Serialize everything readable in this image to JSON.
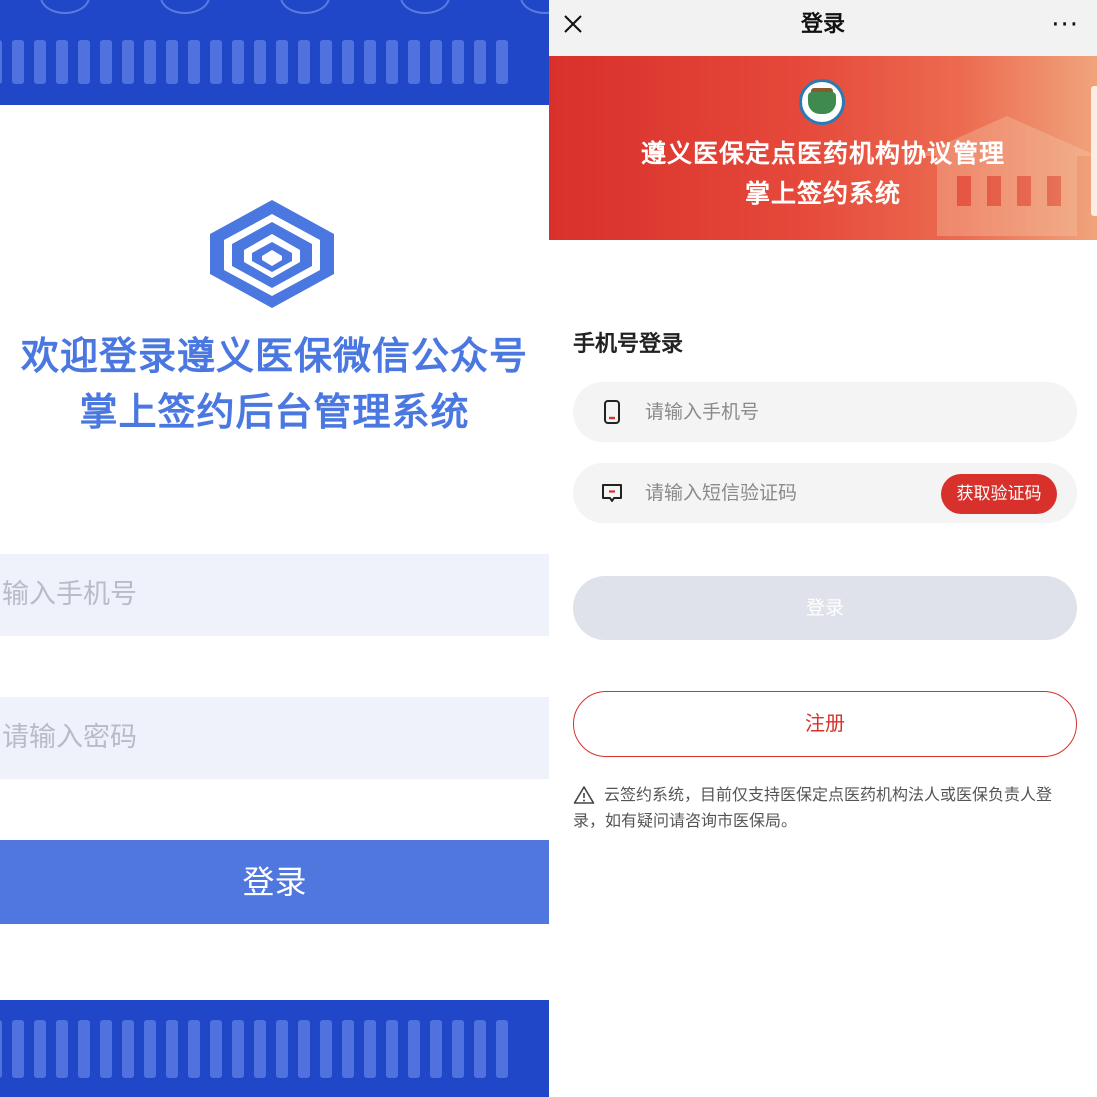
{
  "left_screen": {
    "title_line1": "欢迎登录遵义医保微信公众号",
    "title_line2": "掌上签约后台管理系统",
    "phone_placeholder": "输入手机号",
    "password_placeholder": "请输入密码",
    "login_label": "登录",
    "colors": {
      "primary": "#4f77dd",
      "band": "#1f47c8",
      "title": "#4a78e0",
      "input_bg": "#eff2fa"
    }
  },
  "right_screen": {
    "topbar": {
      "title": "登录",
      "close_icon": "close-icon",
      "more": "···"
    },
    "banner": {
      "title_line1": "遵义医保定点医药机构协议管理",
      "title_line2": "掌上签约系统"
    },
    "section_title": "手机号登录",
    "phone_field": {
      "icon": "phone-icon",
      "placeholder": "请输入手机号"
    },
    "code_field": {
      "icon": "message-icon",
      "placeholder": "请输入短信验证码",
      "get_code_label": "获取验证码"
    },
    "login_label": "登录",
    "register_label": "注册",
    "notice": "云签约系统，目前仅支持医保定点医药机构法人或医保负责人登录，如有疑问请咨询市医保局。",
    "colors": {
      "accent": "#d8302b",
      "disabled_button": "#dfe2ea",
      "field_bg": "#f4f4f4"
    }
  }
}
